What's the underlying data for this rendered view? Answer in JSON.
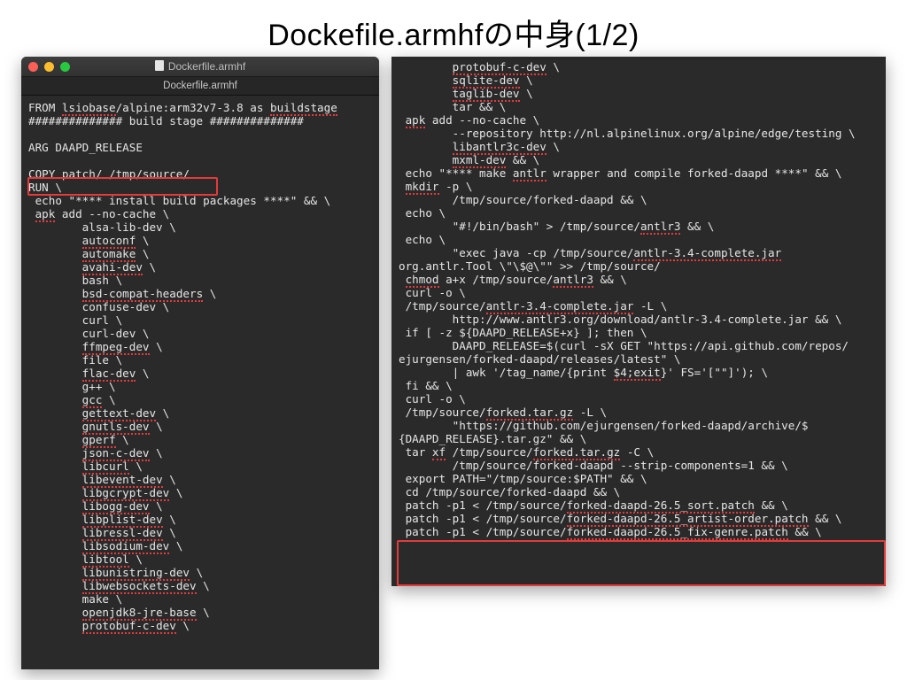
{
  "title": "Dockefile.armhfの中身(1/2)",
  "window_title": "Dockerfile.armhf",
  "tab_title": "Dockerfile.armhf",
  "left_code": [
    {
      "t": "FROM ",
      "u": "lsiobase",
      "t2": "/alpine:arm32v7-3.8 as ",
      "u2": "buildstage"
    },
    {
      "plain": "############## build stage ##############"
    },
    {
      "plain": ""
    },
    {
      "plain": "ARG DAAPD_RELEASE"
    },
    {
      "plain": ""
    },
    {
      "plain": "COPY patch/ /tmp/source/",
      "boxed": true
    },
    {
      "plain": "RUN \\"
    },
    {
      "i": 1,
      "plain": "echo \"**** install build packages ****\" && \\"
    },
    {
      "i": 1,
      "t": "",
      "u": "apk",
      "t2": " add --no-cache \\"
    },
    {
      "i": 2,
      "plain": "alsa-lib-dev \\"
    },
    {
      "i": 2,
      "t": "",
      "u": "autoconf",
      "t2": " \\"
    },
    {
      "i": 2,
      "t": "",
      "u": "automake",
      "t2": " \\"
    },
    {
      "i": 2,
      "t": "",
      "u": "avahi-dev",
      "t2": " \\"
    },
    {
      "i": 2,
      "plain": "bash \\"
    },
    {
      "i": 2,
      "t": "",
      "u": "bsd-compat-headers",
      "t2": " \\"
    },
    {
      "i": 2,
      "plain": "confuse-dev \\"
    },
    {
      "i": 2,
      "plain": "curl \\"
    },
    {
      "i": 2,
      "plain": "curl-dev \\"
    },
    {
      "i": 2,
      "t": "",
      "u": "ffmpeg-dev",
      "t2": " \\"
    },
    {
      "i": 2,
      "plain": "file \\"
    },
    {
      "i": 2,
      "t": "",
      "u": "flac-dev",
      "t2": " \\"
    },
    {
      "i": 2,
      "plain": "g++ \\"
    },
    {
      "i": 2,
      "t": "",
      "u": "gcc",
      "t2": " \\"
    },
    {
      "i": 2,
      "t": "",
      "u": "gettext-dev",
      "t2": " \\"
    },
    {
      "i": 2,
      "t": "",
      "u": "gnutls-dev",
      "t2": " \\"
    },
    {
      "i": 2,
      "t": "",
      "u": "gperf",
      "t2": " \\"
    },
    {
      "i": 2,
      "t": "",
      "u": "json-c-dev",
      "t2": " \\"
    },
    {
      "i": 2,
      "t": "",
      "u": "libcurl",
      "t2": " \\"
    },
    {
      "i": 2,
      "t": "",
      "u": "libevent-dev",
      "t2": " \\"
    },
    {
      "i": 2,
      "t": "",
      "u": "libgcrypt-dev",
      "t2": " \\"
    },
    {
      "i": 2,
      "t": "",
      "u": "libogg-dev",
      "t2": " \\"
    },
    {
      "i": 2,
      "t": "",
      "u": "libplist-dev",
      "t2": " \\"
    },
    {
      "i": 2,
      "t": "",
      "u": "libressl-dev",
      "t2": " \\"
    },
    {
      "i": 2,
      "t": "",
      "u": "libsodium-dev",
      "t2": " \\"
    },
    {
      "i": 2,
      "t": "",
      "u": "libtool",
      "t2": " \\"
    },
    {
      "i": 2,
      "t": "",
      "u": "libunistring-dev",
      "t2": " \\"
    },
    {
      "i": 2,
      "t": "",
      "u": "libwebsockets-dev",
      "t2": " \\"
    },
    {
      "i": 2,
      "plain": "make \\"
    },
    {
      "i": 2,
      "t": "",
      "u": "openjdk8-jre-base",
      "t2": " \\"
    },
    {
      "i": 2,
      "t": "",
      "u": "protobuf-c-dev",
      "t2": " \\"
    }
  ],
  "right_code": [
    {
      "i": 2,
      "t": "",
      "u": "protobuf-c-dev",
      "t2": " \\"
    },
    {
      "i": 2,
      "t": "",
      "u": "sqlite-dev",
      "t2": " \\"
    },
    {
      "i": 2,
      "t": "",
      "u": "taglib-dev",
      "t2": " \\"
    },
    {
      "i": 2,
      "plain": "tar && \\"
    },
    {
      "i": 1,
      "t": "",
      "u": "apk",
      "t2": " add --no-cache \\"
    },
    {
      "i": 2,
      "plain": "--repository http://nl.alpinelinux.org/alpine/edge/testing \\"
    },
    {
      "i": 2,
      "t": "",
      "u": "libantlr3c-dev",
      "t2": " \\"
    },
    {
      "i": 2,
      "t": "",
      "u": "mxml-dev",
      "t2": " && \\"
    },
    {
      "i": 1,
      "t": "echo \"**** make ",
      "u": "antlr",
      "t2": " wrapper and compile forked-daapd ****\" && \\"
    },
    {
      "i": 1,
      "t": "",
      "u": "mkdir",
      "t2": " -p \\"
    },
    {
      "i": 2,
      "plain": "/tmp/source/forked-daapd && \\"
    },
    {
      "i": 1,
      "plain": "echo \\"
    },
    {
      "i": 2,
      "t": "\"#!/bin/bash\" > /tmp/source/",
      "u": "antlr3",
      "t2": " && \\"
    },
    {
      "i": 1,
      "plain": "echo \\"
    },
    {
      "i": 2,
      "t": "\"exec java -cp /tmp/source/",
      "u": "antlr-3.4-complete.jar",
      "t2": ""
    },
    {
      "plain": "org.antlr.Tool \\\"\\$@\\\"\" >> /tmp/source/",
      "u": "antlr3",
      "t2": " && \\"
    },
    {
      "i": 1,
      "t": "",
      "u": "chmod",
      "t2": " a+x /tmp/source/",
      "u2": "antlr3",
      "t3": " && \\"
    },
    {
      "i": 1,
      "plain": "curl -o \\"
    },
    {
      "i": 1,
      "t": "/tmp/source/",
      "u": "antlr-3.4-complete.jar",
      "t2": " -L \\"
    },
    {
      "i": 2,
      "plain": "http://www.antlr3.org/download/antlr-3.4-complete.jar && \\"
    },
    {
      "i": 1,
      "plain": "if [ -z ${DAAPD_RELEASE+x} ]; then \\"
    },
    {
      "i": 2,
      "plain": "DAAPD_RELEASE=$(curl -sX GET \"https://api.github.com/repos/"
    },
    {
      "plain": "ejurgensen/forked-daapd/releases/latest\" \\"
    },
    {
      "i": 2,
      "t": "| awk '/tag_name/{print ",
      "u": "$4;exit",
      "t2": "}' FS='[\"\"]'); \\"
    },
    {
      "i": 1,
      "plain": "fi && \\"
    },
    {
      "i": 1,
      "plain": "curl -o \\"
    },
    {
      "i": 1,
      "t": "/tmp/source/",
      "u": "forked.tar.gz",
      "t2": " -L \\"
    },
    {
      "i": 2,
      "plain": "\"https://github.com/ejurgensen/forked-daapd/archive/$"
    },
    {
      "plain": "{DAAPD_RELEASE}.tar.gz\" && \\"
    },
    {
      "i": 1,
      "t": "tar ",
      "u": "xf",
      "t2": " /tmp/source/",
      "u2": "forked.tar.gz",
      "t3": " -C \\"
    },
    {
      "i": 2,
      "plain": "/tmp/source/forked-daapd --strip-components=1 && \\"
    },
    {
      "i": 1,
      "plain": "export PATH=\"/tmp/source:$PATH\" && \\"
    },
    {
      "i": 1,
      "plain": "cd /tmp/source/forked-daapd && \\"
    },
    {
      "i": 1,
      "t": "patch -p1 < /tmp/source/",
      "u": "forked-daapd-26.5_sort.patch",
      "t2": " && \\"
    },
    {
      "i": 1,
      "t": "patch -p1 < /tmp/source/",
      "u": "forked-daapd-26.5_artist-order.patch",
      "t2": " && \\"
    },
    {
      "i": 1,
      "t": "patch -p1 < /tmp/source/",
      "u": "forked-daapd-26.5_fix-genre.patch",
      "t2": " && \\"
    }
  ]
}
